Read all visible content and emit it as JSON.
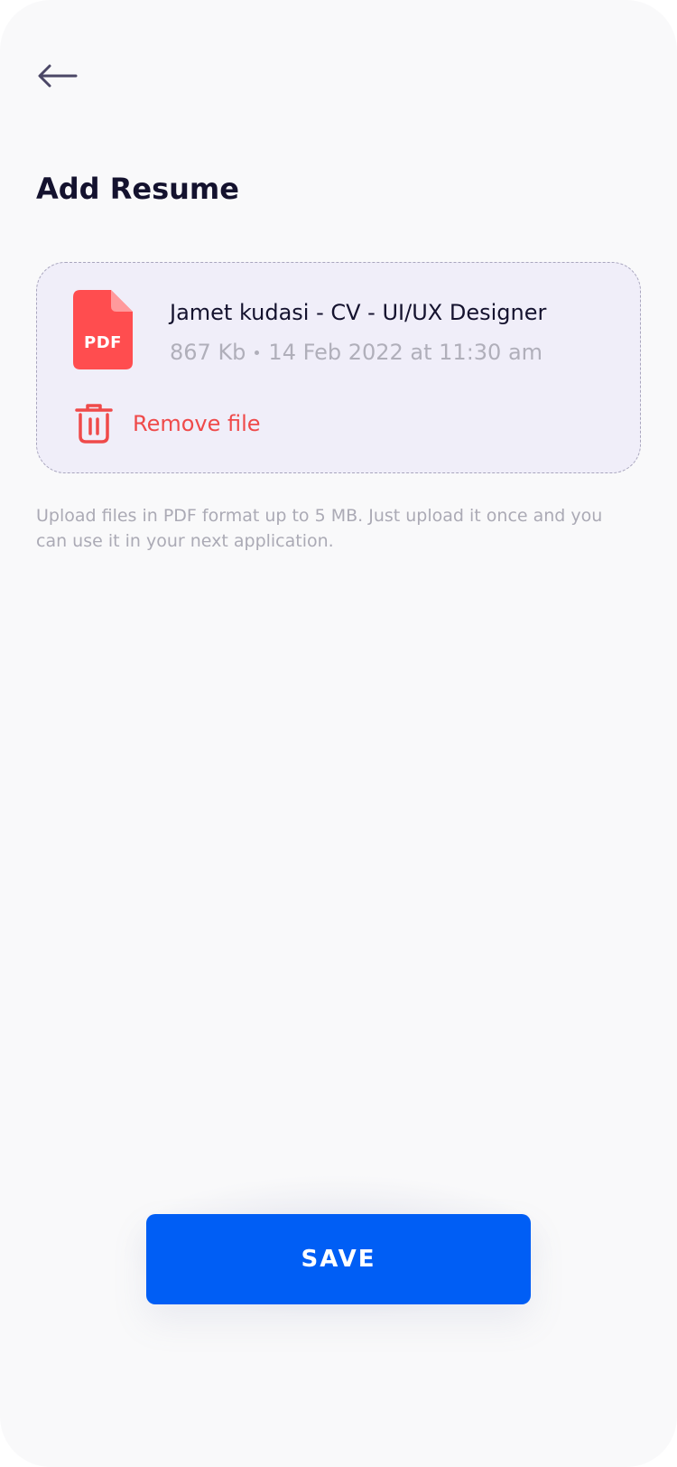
{
  "header": {
    "back_icon": "arrow-left-icon",
    "title": "Add Resume"
  },
  "file_card": {
    "file_icon": "pdf-file-icon",
    "file_icon_label": "PDF",
    "file_name": "Jamet kudasi - CV - UI/UX Designer",
    "file_size": "867 Kb",
    "file_date": "14 Feb 2022 at 11:30 am",
    "remove_icon": "trash-icon",
    "remove_label": "Remove file"
  },
  "helper_text": "Upload files in PDF format up to 5 MB. Just upload it once and you can use it in your next application.",
  "actions": {
    "save_label": "SAVE"
  },
  "colors": {
    "background": "#F9F9FA",
    "title": "#14122E",
    "card_background": "#F0EEF9",
    "card_border": "#A9A6BE",
    "pdf_red": "#FF4D4F",
    "remove_red": "#EF4A4A",
    "muted_text": "#ABAAB5",
    "primary_button": "#005EF5"
  }
}
